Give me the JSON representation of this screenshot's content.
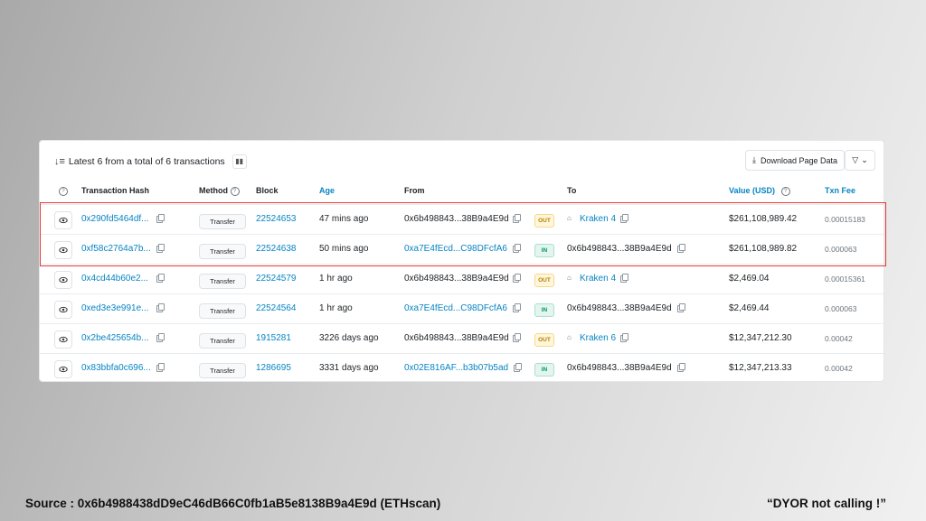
{
  "header": {
    "summary": "Latest 6 from a total of 6 transactions",
    "download_label": "Download Page Data"
  },
  "columns": {
    "hash": "Transaction Hash",
    "method": "Method",
    "block": "Block",
    "age": "Age",
    "from": "From",
    "to": "To",
    "value": "Value (USD)",
    "fee": "Txn Fee"
  },
  "rows": [
    {
      "hash": "0x290fd5464df...",
      "method": "Transfer",
      "block": "22524653",
      "age": "47 mins ago",
      "from": "0x6b498843...38B9a4E9d",
      "from_link": false,
      "dir": "OUT",
      "to": "Kraken 4",
      "to_link": true,
      "value": "$261,108,989.42",
      "fee": "0.00015183"
    },
    {
      "hash": "0xf58c2764a7b...",
      "method": "Transfer",
      "block": "22524638",
      "age": "50 mins ago",
      "from": "0xa7E4fEcd...C98DFcfA6",
      "from_link": true,
      "dir": "IN",
      "to": "0x6b498843...38B9a4E9d",
      "to_link": false,
      "value": "$261,108,989.82",
      "fee": "0.000063"
    },
    {
      "hash": "0x4cd44b60e2...",
      "method": "Transfer",
      "block": "22524579",
      "age": "1 hr ago",
      "from": "0x6b498843...38B9a4E9d",
      "from_link": false,
      "dir": "OUT",
      "to": "Kraken 4",
      "to_link": true,
      "value": "$2,469.04",
      "fee": "0.00015361"
    },
    {
      "hash": "0xed3e3e991e...",
      "method": "Transfer",
      "block": "22524564",
      "age": "1 hr ago",
      "from": "0xa7E4fEcd...C98DFcfA6",
      "from_link": true,
      "dir": "IN",
      "to": "0x6b498843...38B9a4E9d",
      "to_link": false,
      "value": "$2,469.44",
      "fee": "0.000063"
    },
    {
      "hash": "0x2be425654b...",
      "method": "Transfer",
      "block": "1915281",
      "age": "3226 days ago",
      "from": "0x6b498843...38B9a4E9d",
      "from_link": false,
      "dir": "OUT",
      "to": "Kraken 6",
      "to_link": true,
      "value": "$12,347,212.30",
      "fee": "0.00042"
    },
    {
      "hash": "0x83bbfa0c696...",
      "method": "Transfer",
      "block": "1286695",
      "age": "3331 days ago",
      "from": "0x02E816AF...b3b07b5ad",
      "from_link": true,
      "dir": "IN",
      "to": "0x6b498843...38B9a4E9d",
      "to_link": false,
      "value": "$12,347,213.33",
      "fee": "0.00042"
    }
  ],
  "footer": {
    "source": "Source : 0x6b4988438dD9eC46dB66C0fb1aB5e8138B9a4E9d (ETHscan)",
    "note": "“DYOR  not calling !”"
  },
  "colors": {
    "link": "#0784c3",
    "out_badge": "#b58200",
    "in_badge": "#00976b",
    "highlight_border": "#e53935"
  }
}
